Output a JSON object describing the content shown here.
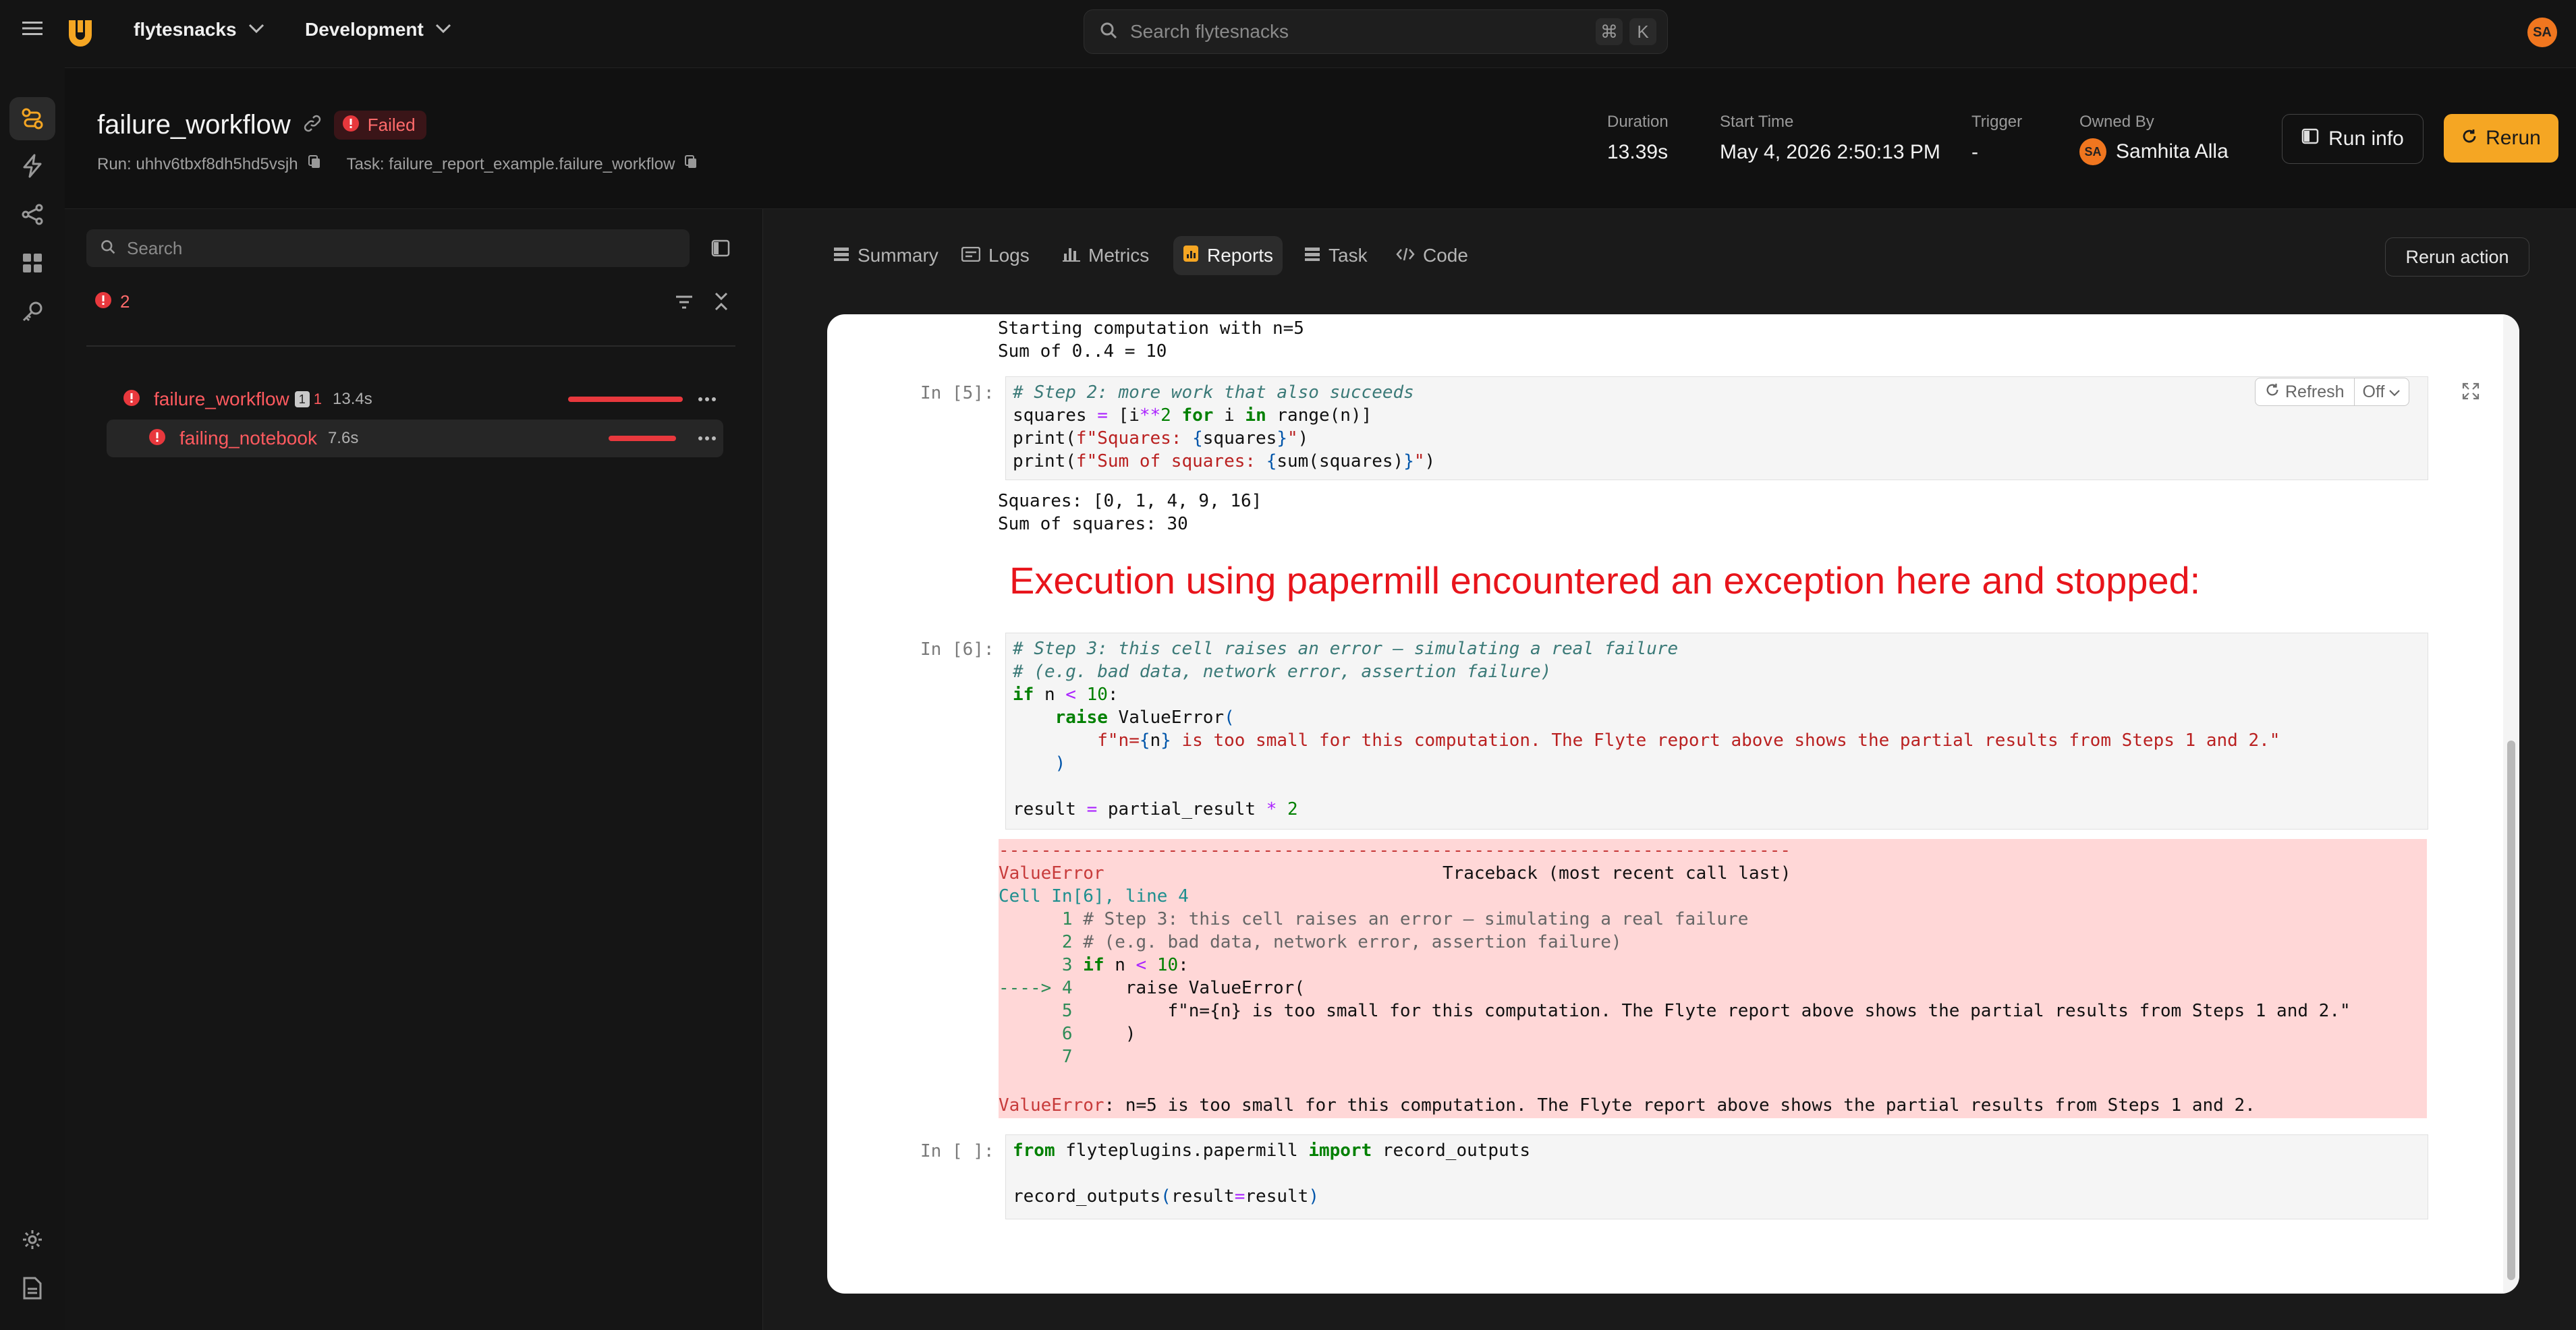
{
  "topbar": {
    "project": "flytesnacks",
    "domain": "Development",
    "search_placeholder": "Search flytesnacks",
    "kbd_cmd": "⌘",
    "kbd_k": "K",
    "user_initials": "SA"
  },
  "header": {
    "workflow_name": "failure_workflow",
    "status": "Failed",
    "run_label": "Run: uhhv6tbxf8dh5hd5vsjh",
    "task_label": "Task: failure_report_example.failure_workflow",
    "duration_label": "Duration",
    "duration_value": "13.39s",
    "start_label": "Start Time",
    "start_value": "May 4, 2026 2:50:13 PM",
    "trigger_label": "Trigger",
    "trigger_value": "-",
    "owner_label": "Owned By",
    "owner_initials": "SA",
    "owner_name": "Samhita Alla",
    "run_info_button": "Run info",
    "rerun_button": "Rerun"
  },
  "side": {
    "search_placeholder": "Search",
    "error_count": "2",
    "tree": [
      {
        "name": "failure_workflow",
        "badge": "1",
        "count": "1",
        "duration": "13.4s",
        "progress": 1.0
      },
      {
        "name": "failing_notebook",
        "duration": "7.6s",
        "progress": 1.0
      }
    ]
  },
  "tabs": [
    "Summary",
    "Logs",
    "Metrics",
    "Reports",
    "Task",
    "Code"
  ],
  "active_tab": "Reports",
  "rerun_action_button": "Rerun action",
  "notebook": {
    "refresh_label": "Refresh",
    "autorefresh_value": "Off",
    "out_top_1": "Starting computation with n=5",
    "out_top_2": "Sum of 0..4 = 10",
    "prompt_5": "In [5]:",
    "out_5_1": "Squares: [0, 1, 4, 9, 16]",
    "out_5_2": "Sum of squares: 30",
    "exception_banner": "Execution using papermill encountered an exception here and stopped:",
    "prompt_6": "In [6]:",
    "prompt_empty": "In [ ]:",
    "tb_dashes": "---------------------------------------------------------------------------",
    "tb_error_name": "ValueError",
    "tb_header": "Traceback (most recent call last)",
    "tb_cell": "Cell In[6], line 4",
    "tb_arrow": "---->",
    "tb_final_msg": ": n=5 is too small for this computation. The Flyte report above shows the partial results from Steps 1 and 2."
  }
}
